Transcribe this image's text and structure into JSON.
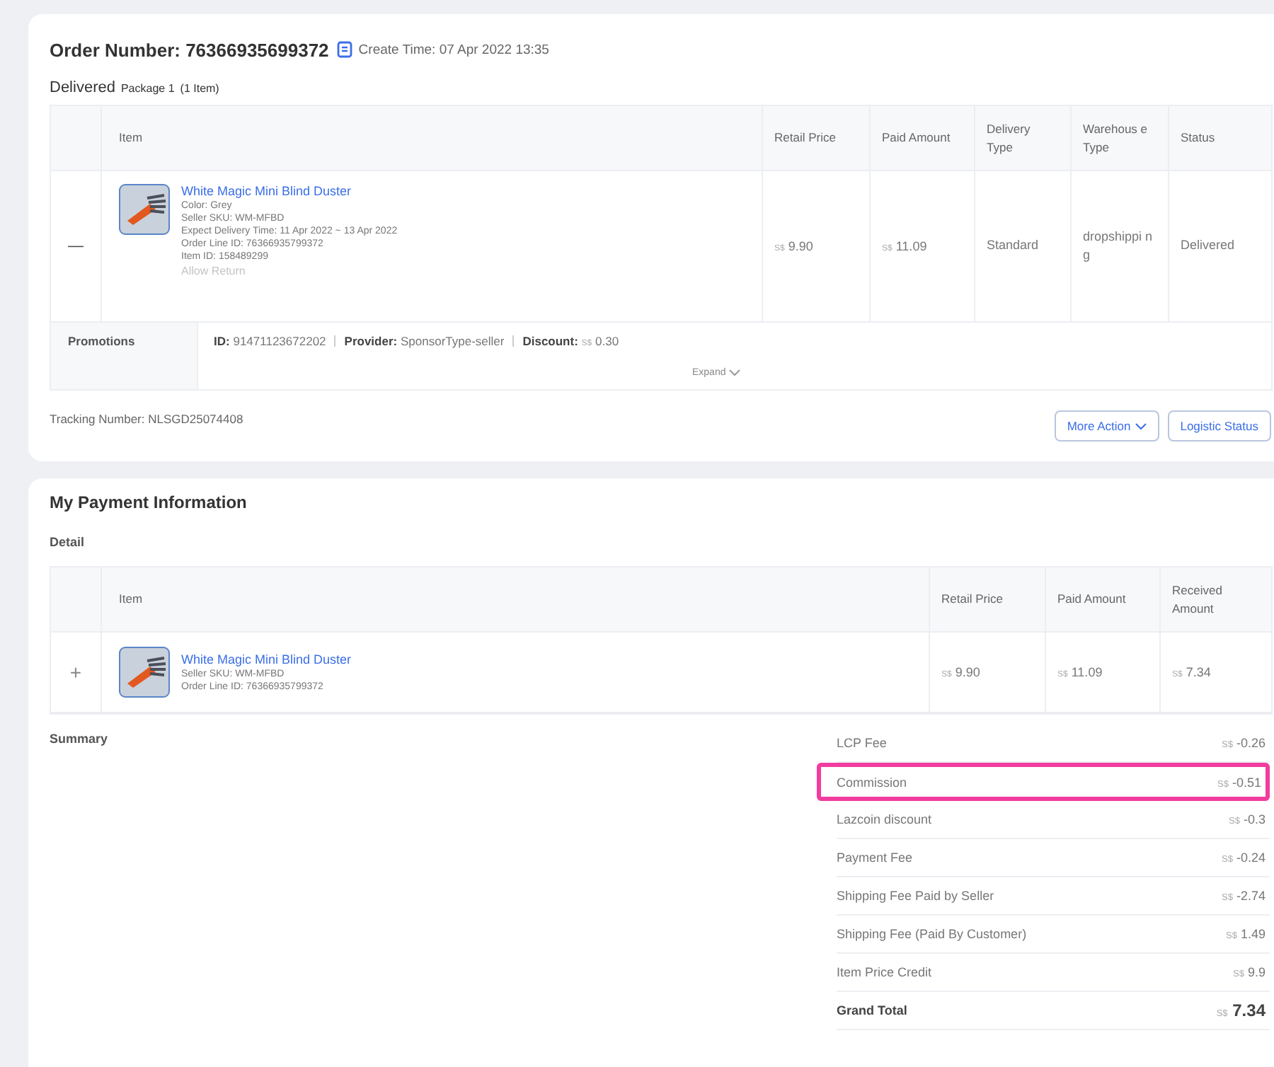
{
  "order": {
    "number_label": "Order Number: 76366935699372",
    "create_time": "Create Time: 07 Apr 2022 13:35"
  },
  "package": {
    "status": "Delivered",
    "label": "Package 1",
    "count": "(1 Item)"
  },
  "order_table": {
    "columns": [
      "Item",
      "Retail Price",
      "Paid Amount",
      "Delivery Type",
      "Warehous e Type",
      "Status"
    ],
    "rows": [
      {
        "toggle": "—",
        "name": "White Magic Mini Blind Duster",
        "details": [
          "Color: Grey",
          "Seller SKU: WM-MFBD",
          "Expect Delivery Time: 11 Apr 2022 ~ 13 Apr 2022",
          "Order Line ID: 76366935799372",
          "Item ID: 158489299"
        ],
        "allow_return": {
          "label": "Allow Return",
          "disabled": true
        },
        "retail": {
          "currency": "S$",
          "amount": "9.90"
        },
        "paid": {
          "currency": "S$",
          "amount": "11.09"
        },
        "delivery_type": "Standard",
        "warehouse_type": "dropshippi ng",
        "status": "Delivered"
      }
    ]
  },
  "promotions": {
    "label": "Promotions",
    "items": [
      {
        "label": "ID:",
        "value": "91471123672202"
      },
      {
        "label": "Provider:",
        "value": "SponsorType-seller"
      },
      {
        "label": "Discount:",
        "currency": "S$",
        "value": "0.30"
      }
    ],
    "expand": "Expand"
  },
  "tracking": "Tracking Number: NLSGD25074408",
  "buttons": [
    {
      "label": "More Action",
      "dropdown": true
    },
    {
      "label": "Logistic Status",
      "dropdown": false
    }
  ],
  "payment": {
    "title": "My Payment Information",
    "detail": "Detail",
    "columns": [
      "Item",
      "Retail Price",
      "Paid Amount",
      "Received Amount"
    ],
    "rows": [
      {
        "toggle": "+",
        "name": "White Magic Mini Blind Duster",
        "details": [
          "Seller SKU: WM-MFBD",
          "Order Line ID: 76366935799372"
        ],
        "retail": {
          "currency": "S$",
          "amount": "9.90"
        },
        "paid": {
          "currency": "S$",
          "amount": "11.09"
        },
        "received": {
          "currency": "S$",
          "amount": "7.34"
        }
      }
    ],
    "summary_label": "Summary",
    "summary": [
      {
        "kind": "fee",
        "label": "LCP Fee",
        "currency": "S$",
        "amount": "-0.26",
        "highlighted": false
      },
      {
        "kind": "fee",
        "label": "Commission",
        "currency": "S$",
        "amount": "-0.51",
        "highlighted": true
      },
      {
        "kind": "fee",
        "label": "Lazcoin discount",
        "currency": "S$",
        "amount": "-0.3",
        "highlighted": false
      },
      {
        "kind": "fee",
        "label": "Payment Fee",
        "currency": "S$",
        "amount": "-0.24",
        "highlighted": false
      },
      {
        "kind": "fee",
        "label": "Shipping Fee Paid by Seller",
        "currency": "S$",
        "amount": "-2.74",
        "highlighted": false
      },
      {
        "kind": "fee",
        "label": "Shipping Fee (Paid By Customer)",
        "currency": "S$",
        "amount": "1.49",
        "highlighted": false
      },
      {
        "kind": "fee",
        "label": "Item Price Credit",
        "currency": "S$",
        "amount": "9.9",
        "highlighted": false
      },
      {
        "kind": "total",
        "label": "Grand Total",
        "currency": "S$",
        "amount": "7.34",
        "highlighted": false
      }
    ]
  }
}
